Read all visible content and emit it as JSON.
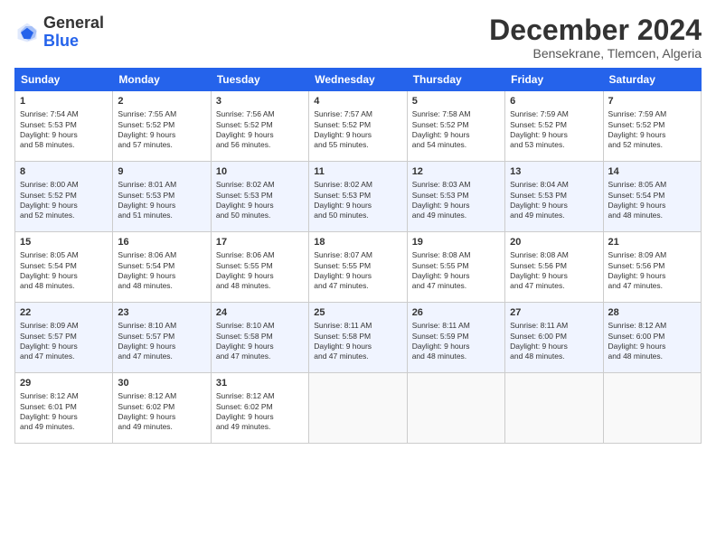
{
  "header": {
    "logo": {
      "general": "General",
      "blue": "Blue"
    },
    "title": "December 2024",
    "subtitle": "Bensekrane, Tlemcen, Algeria"
  },
  "columns": [
    "Sunday",
    "Monday",
    "Tuesday",
    "Wednesday",
    "Thursday",
    "Friday",
    "Saturday"
  ],
  "weeks": [
    [
      {
        "day": "1",
        "info": "Sunrise: 7:54 AM\nSunset: 5:53 PM\nDaylight: 9 hours\nand 58 minutes."
      },
      {
        "day": "2",
        "info": "Sunrise: 7:55 AM\nSunset: 5:52 PM\nDaylight: 9 hours\nand 57 minutes."
      },
      {
        "day": "3",
        "info": "Sunrise: 7:56 AM\nSunset: 5:52 PM\nDaylight: 9 hours\nand 56 minutes."
      },
      {
        "day": "4",
        "info": "Sunrise: 7:57 AM\nSunset: 5:52 PM\nDaylight: 9 hours\nand 55 minutes."
      },
      {
        "day": "5",
        "info": "Sunrise: 7:58 AM\nSunset: 5:52 PM\nDaylight: 9 hours\nand 54 minutes."
      },
      {
        "day": "6",
        "info": "Sunrise: 7:59 AM\nSunset: 5:52 PM\nDaylight: 9 hours\nand 53 minutes."
      },
      {
        "day": "7",
        "info": "Sunrise: 7:59 AM\nSunset: 5:52 PM\nDaylight: 9 hours\nand 52 minutes."
      }
    ],
    [
      {
        "day": "8",
        "info": "Sunrise: 8:00 AM\nSunset: 5:52 PM\nDaylight: 9 hours\nand 52 minutes."
      },
      {
        "day": "9",
        "info": "Sunrise: 8:01 AM\nSunset: 5:53 PM\nDaylight: 9 hours\nand 51 minutes."
      },
      {
        "day": "10",
        "info": "Sunrise: 8:02 AM\nSunset: 5:53 PM\nDaylight: 9 hours\nand 50 minutes."
      },
      {
        "day": "11",
        "info": "Sunrise: 8:02 AM\nSunset: 5:53 PM\nDaylight: 9 hours\nand 50 minutes."
      },
      {
        "day": "12",
        "info": "Sunrise: 8:03 AM\nSunset: 5:53 PM\nDaylight: 9 hours\nand 49 minutes."
      },
      {
        "day": "13",
        "info": "Sunrise: 8:04 AM\nSunset: 5:53 PM\nDaylight: 9 hours\nand 49 minutes."
      },
      {
        "day": "14",
        "info": "Sunrise: 8:05 AM\nSunset: 5:54 PM\nDaylight: 9 hours\nand 48 minutes."
      }
    ],
    [
      {
        "day": "15",
        "info": "Sunrise: 8:05 AM\nSunset: 5:54 PM\nDaylight: 9 hours\nand 48 minutes."
      },
      {
        "day": "16",
        "info": "Sunrise: 8:06 AM\nSunset: 5:54 PM\nDaylight: 9 hours\nand 48 minutes."
      },
      {
        "day": "17",
        "info": "Sunrise: 8:06 AM\nSunset: 5:55 PM\nDaylight: 9 hours\nand 48 minutes."
      },
      {
        "day": "18",
        "info": "Sunrise: 8:07 AM\nSunset: 5:55 PM\nDaylight: 9 hours\nand 47 minutes."
      },
      {
        "day": "19",
        "info": "Sunrise: 8:08 AM\nSunset: 5:55 PM\nDaylight: 9 hours\nand 47 minutes."
      },
      {
        "day": "20",
        "info": "Sunrise: 8:08 AM\nSunset: 5:56 PM\nDaylight: 9 hours\nand 47 minutes."
      },
      {
        "day": "21",
        "info": "Sunrise: 8:09 AM\nSunset: 5:56 PM\nDaylight: 9 hours\nand 47 minutes."
      }
    ],
    [
      {
        "day": "22",
        "info": "Sunrise: 8:09 AM\nSunset: 5:57 PM\nDaylight: 9 hours\nand 47 minutes."
      },
      {
        "day": "23",
        "info": "Sunrise: 8:10 AM\nSunset: 5:57 PM\nDaylight: 9 hours\nand 47 minutes."
      },
      {
        "day": "24",
        "info": "Sunrise: 8:10 AM\nSunset: 5:58 PM\nDaylight: 9 hours\nand 47 minutes."
      },
      {
        "day": "25",
        "info": "Sunrise: 8:11 AM\nSunset: 5:58 PM\nDaylight: 9 hours\nand 47 minutes."
      },
      {
        "day": "26",
        "info": "Sunrise: 8:11 AM\nSunset: 5:59 PM\nDaylight: 9 hours\nand 48 minutes."
      },
      {
        "day": "27",
        "info": "Sunrise: 8:11 AM\nSunset: 6:00 PM\nDaylight: 9 hours\nand 48 minutes."
      },
      {
        "day": "28",
        "info": "Sunrise: 8:12 AM\nSunset: 6:00 PM\nDaylight: 9 hours\nand 48 minutes."
      }
    ],
    [
      {
        "day": "29",
        "info": "Sunrise: 8:12 AM\nSunset: 6:01 PM\nDaylight: 9 hours\nand 49 minutes."
      },
      {
        "day": "30",
        "info": "Sunrise: 8:12 AM\nSunset: 6:02 PM\nDaylight: 9 hours\nand 49 minutes."
      },
      {
        "day": "31",
        "info": "Sunrise: 8:12 AM\nSunset: 6:02 PM\nDaylight: 9 hours\nand 49 minutes."
      },
      {
        "day": "",
        "info": ""
      },
      {
        "day": "",
        "info": ""
      },
      {
        "day": "",
        "info": ""
      },
      {
        "day": "",
        "info": ""
      }
    ]
  ]
}
